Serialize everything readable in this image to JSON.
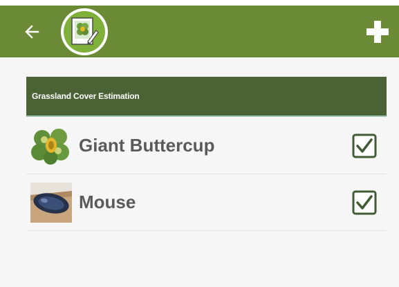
{
  "toolbar": {
    "back_icon": "arrow-left-icon",
    "logo_icon": "plant-survey-logo-icon",
    "add_icon": "plus-icon"
  },
  "section": {
    "title": "Grassland Cover Estimation"
  },
  "items": [
    {
      "label": "Giant Buttercup",
      "thumbnail": "buttercup-thumbnail",
      "checked": true
    },
    {
      "label": "Mouse",
      "thumbnail": "mouse-thumbnail",
      "checked": true
    }
  ],
  "colors": {
    "app_bar": "#6a8a35",
    "section_header": "#4b6234",
    "checkbox": "#3f5c33"
  }
}
